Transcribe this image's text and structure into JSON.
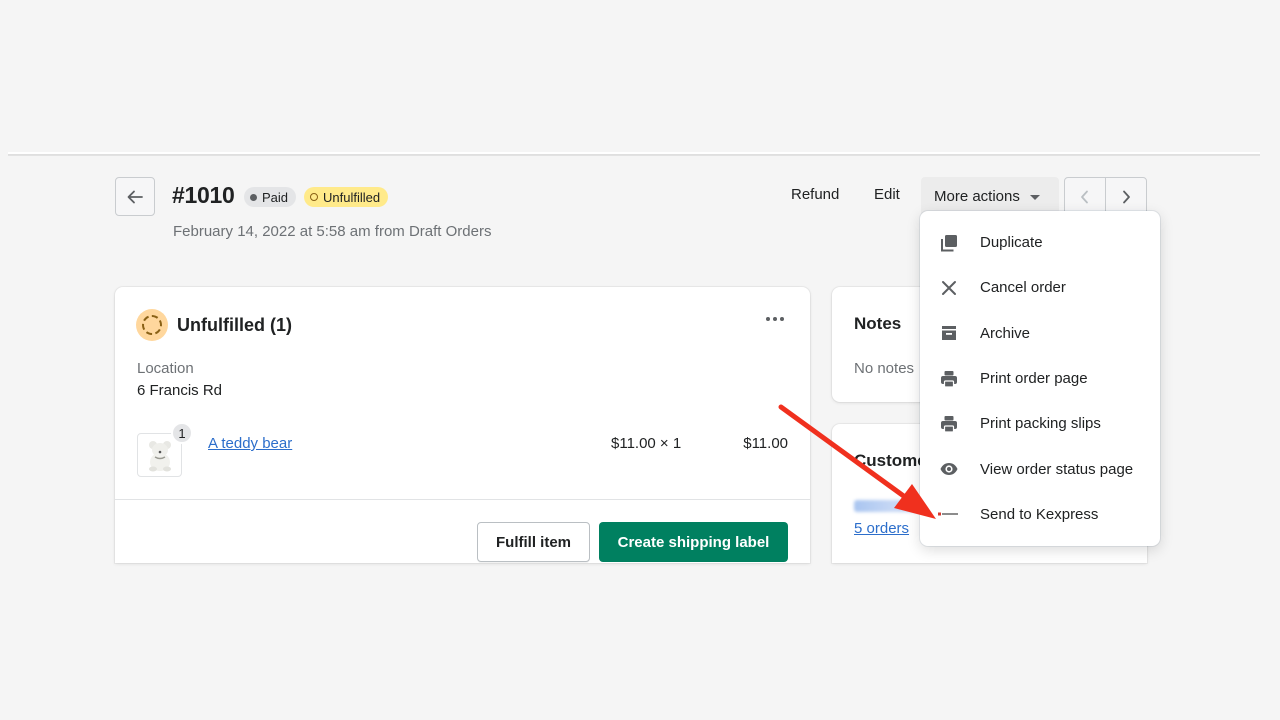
{
  "header": {
    "back_label": "Back",
    "order_number": "#1010",
    "badges": {
      "paid": "Paid",
      "unfulfilled": "Unfulfilled"
    },
    "subtitle": "February 14, 2022 at 5:58 am from Draft Orders",
    "actions": {
      "refund": "Refund",
      "edit": "Edit",
      "more_actions": "More actions"
    }
  },
  "more_actions_menu": {
    "items": [
      {
        "label": "Duplicate",
        "icon": "duplicate-icon"
      },
      {
        "label": "Cancel order",
        "icon": "close-icon"
      },
      {
        "label": "Archive",
        "icon": "archive-icon"
      },
      {
        "label": "Print order page",
        "icon": "printer-icon"
      },
      {
        "label": "Print packing slips",
        "icon": "printer-icon"
      },
      {
        "label": "View order status page",
        "icon": "eye-icon"
      },
      {
        "label": "Send to Kexpress",
        "icon": "kexpress-logo-icon"
      }
    ]
  },
  "fulfillment_card": {
    "title": "Unfulfilled (1)",
    "location_label": "Location",
    "location_value": "6 Francis Rd",
    "line_item": {
      "quantity_badge": "1",
      "name": "A teddy bear",
      "price_x_qty": "$11.00 × 1",
      "total": "$11.00"
    },
    "buttons": {
      "fulfill": "Fulfill item",
      "create_label": "Create shipping label"
    }
  },
  "notes_card": {
    "title": "Notes",
    "empty_text": "No notes"
  },
  "customer_card": {
    "title": "Customer",
    "orders_link": "5 orders"
  },
  "colors": {
    "primary_green": "#008060",
    "link_blue": "#2c6ecb",
    "unfulfilled_yellow": "#ffea8a",
    "annotation_red": "#f0301e"
  }
}
